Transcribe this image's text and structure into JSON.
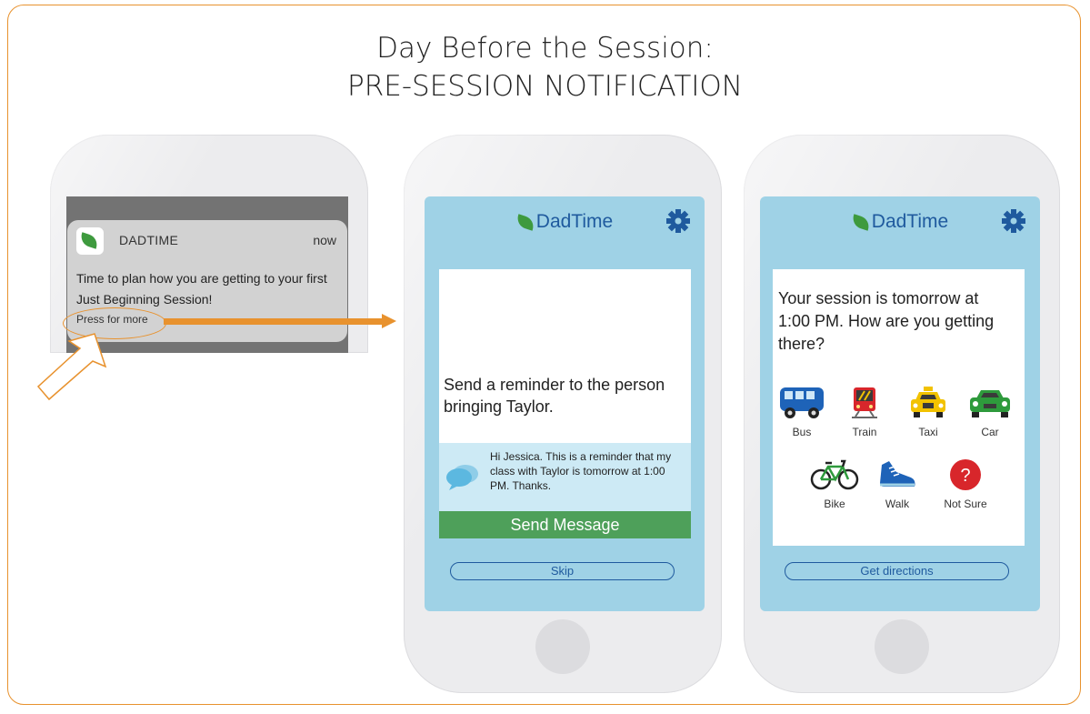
{
  "title": {
    "line1": "Day Before the Session:",
    "line2": "PRE-SESSION NOTIFICATION"
  },
  "notification": {
    "app_name": "DADTIME",
    "time": "now",
    "message": "Time to plan how you are getting to your first Just Beginning Session!",
    "press_label": "Press for more"
  },
  "app": {
    "brand": "DadTime",
    "colors": {
      "brand": "#1f5a9e",
      "screen": "#9fd2e6",
      "leaf": "#3e9a3e",
      "accent": "#e8922e",
      "send": "#4ea05a"
    }
  },
  "reminder_screen": {
    "prompt": "Send a reminder to the person bringing Taylor.",
    "message": "Hi Jessica. This is a reminder that my class with Taylor is tomorrow at 1:00 PM. Thanks.",
    "send_label": "Send Message",
    "skip_label": "Skip"
  },
  "transport_screen": {
    "question": "Your session is tomorrow at 1:00 PM. How are you getting there?",
    "modes": [
      {
        "label": "Bus",
        "icon": "bus-icon"
      },
      {
        "label": "Train",
        "icon": "train-icon"
      },
      {
        "label": "Taxi",
        "icon": "taxi-icon"
      },
      {
        "label": "Car",
        "icon": "car-icon"
      },
      {
        "label": "Bike",
        "icon": "bike-icon"
      },
      {
        "label": "Walk",
        "icon": "shoe-icon"
      },
      {
        "label": "Not Sure",
        "icon": "question-icon"
      }
    ],
    "not_sure_symbol": "?",
    "directions_label": "Get directions"
  }
}
